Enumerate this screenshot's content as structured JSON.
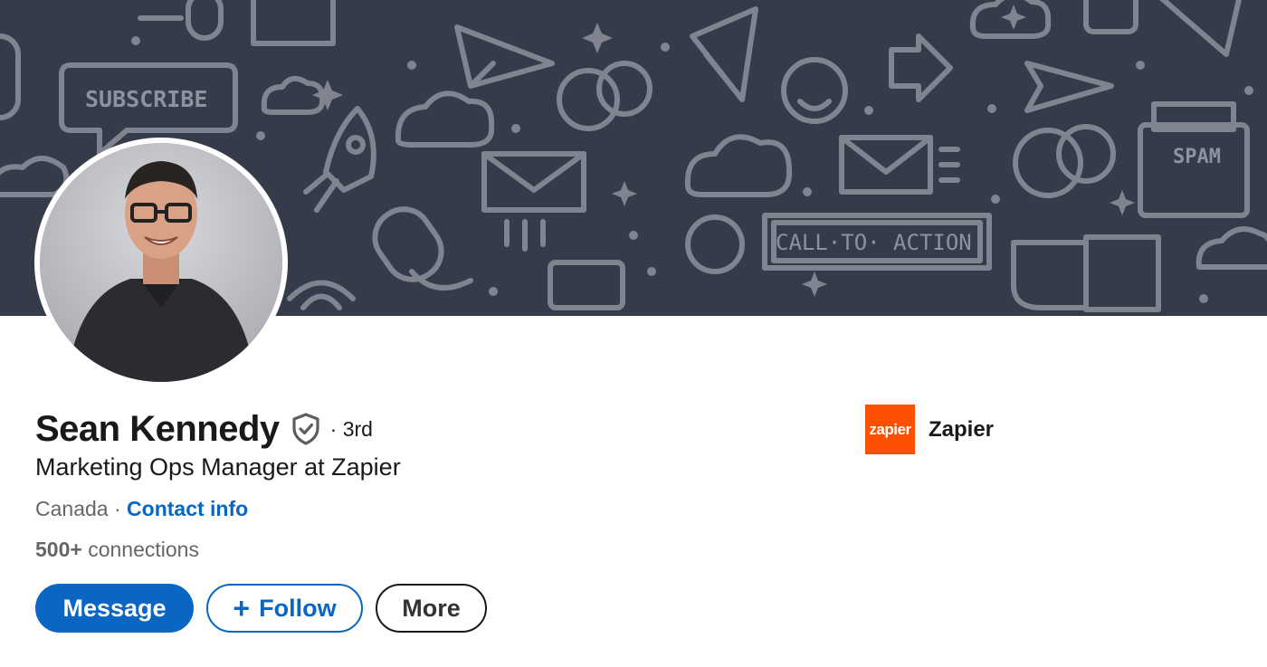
{
  "banner": {
    "subscribe_text": "SUBSCRIBE",
    "cta_text": "CALL·TO· ACTION",
    "spam_text": "SPAM"
  },
  "profile": {
    "name": "Sean Kennedy",
    "degree": "· 3rd",
    "headline": "Marketing Ops Manager at Zapier",
    "location": "Canada",
    "separator": " · ",
    "contact_info": "Contact info",
    "connections_count": "500+",
    "connections_label": " connections"
  },
  "actions": {
    "message": "Message",
    "follow_icon": "+",
    "follow": "Follow",
    "more": "More"
  },
  "company": {
    "logo_text": "zapier",
    "name": "Zapier",
    "logo_color": "#ff4f00"
  },
  "colors": {
    "primary": "#0a66c2",
    "banner": "#363b49"
  },
  "icons": [
    "verified-shield-icon",
    "plus-icon"
  ]
}
